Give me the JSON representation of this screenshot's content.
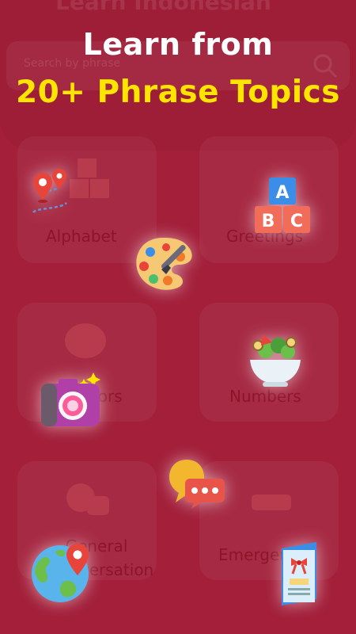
{
  "promo": {
    "line1": "Learn from",
    "line2": "20+ Phrase Topics",
    "line2_color": "#fde500"
  },
  "app_background": {
    "title": "Learn Indonesian",
    "search_placeholder": "Search by phrase",
    "topics": [
      {
        "label": "Alphabet"
      },
      {
        "label": "Greetings"
      },
      {
        "label": "Colors"
      },
      {
        "label": "Numbers"
      },
      {
        "label": "General Conversation"
      },
      {
        "label": "Emergency"
      }
    ]
  },
  "icons": [
    "map-route-icon",
    "abc-blocks-icon",
    "paint-palette-icon",
    "salad-bowl-icon",
    "camera-icon",
    "chat-bubbles-icon",
    "globe-pin-icon",
    "greeting-card-icon"
  ],
  "colors": {
    "background": "#a31f3a",
    "accent": "#fde500",
    "text": "#ffffff"
  }
}
